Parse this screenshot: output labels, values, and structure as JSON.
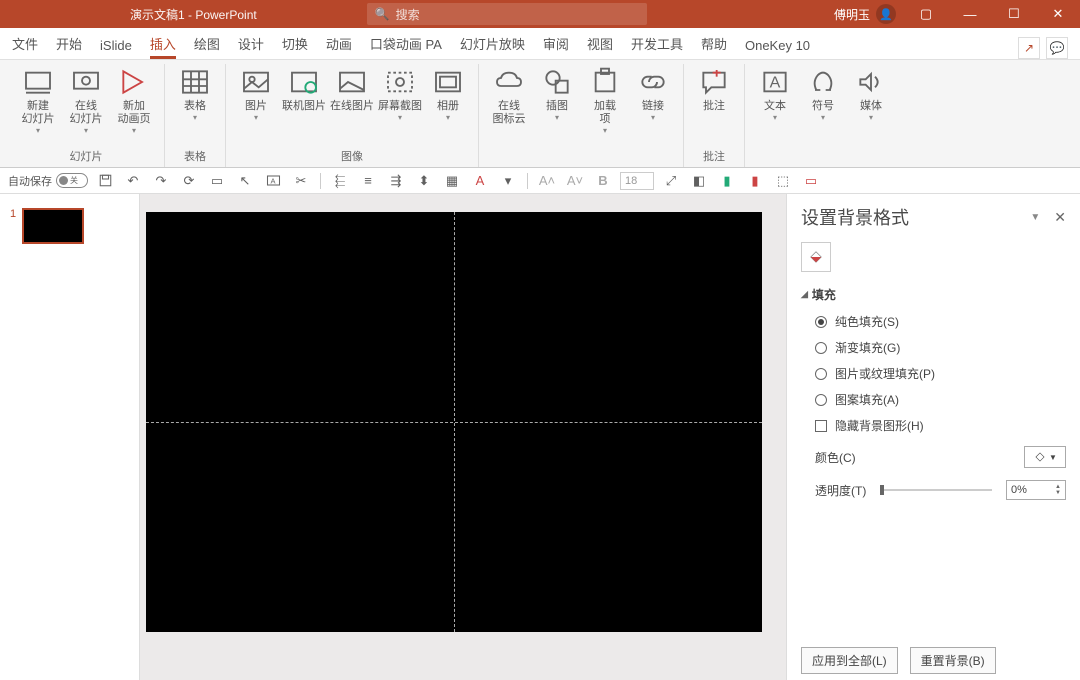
{
  "title": "演示文稿1 - PowerPoint",
  "search_placeholder": "搜索",
  "user": "傅明玉",
  "tabs": [
    "文件",
    "开始",
    "iSlide",
    "插入",
    "绘图",
    "设计",
    "切换",
    "动画",
    "口袋动画 PA",
    "幻灯片放映",
    "审阅",
    "视图",
    "开发工具",
    "帮助",
    "OneKey 10"
  ],
  "active_tab": 3,
  "ribbon": {
    "g1_label": "幻灯片",
    "new_slide": "新建\n幻灯片",
    "online_slide": "在线\n幻灯片",
    "anim_page": "新加\n动画页",
    "g2_label": "表格",
    "table": "表格",
    "g3_label": "图像",
    "picture": "图片",
    "online_pic": "联机图片",
    "web_pic": "在线图片",
    "screenshot": "屏幕截图",
    "album": "相册",
    "icon_cloud": "在线\n图标云",
    "illustration": "插图",
    "addin": "加载\n项",
    "link": "链接",
    "g4_label": "批注",
    "comment": "批注",
    "text": "文本",
    "symbol": "符号",
    "media": "媒体"
  },
  "qat": {
    "autosave": "自动保存",
    "autosave_state": "关",
    "fontsize": "18"
  },
  "thumb_num": "1",
  "pane": {
    "title": "设置背景格式",
    "section": "填充",
    "solid": "纯色填充(S)",
    "gradient": "渐变填充(G)",
    "picture": "图片或纹理填充(P)",
    "pattern": "图案填充(A)",
    "hide_bg": "隐藏背景图形(H)",
    "color": "颜色(C)",
    "transparency": "透明度(T)",
    "pct": "0%",
    "apply_all": "应用到全部(L)",
    "reset": "重置背景(B)"
  }
}
